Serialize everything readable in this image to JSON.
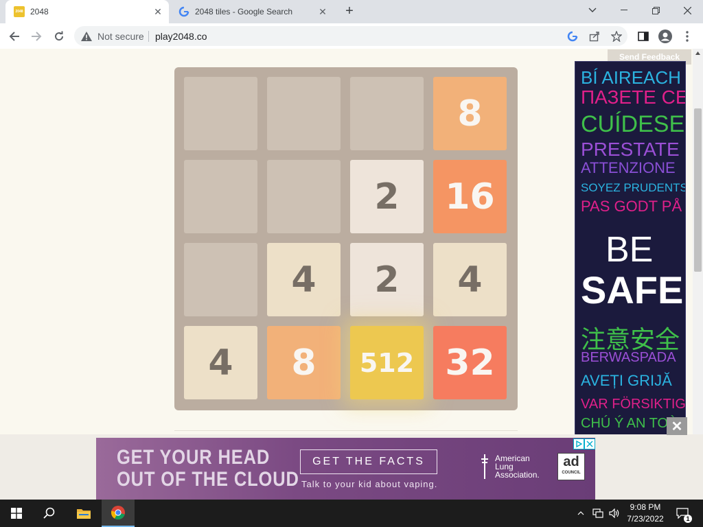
{
  "browser": {
    "tabs": [
      {
        "title": "2048",
        "favicon_text": "2048"
      },
      {
        "title": "2048 tiles - Google Search"
      }
    ],
    "omnibox": {
      "security": "Not secure",
      "url": "play2048.co"
    }
  },
  "game": {
    "tiles": [
      [
        "",
        "",
        "",
        "8"
      ],
      [
        "",
        "",
        "2",
        "16"
      ],
      [
        "",
        "4",
        "2",
        "4"
      ],
      [
        "4",
        "8",
        "512",
        "32"
      ]
    ]
  },
  "side_ad": {
    "feedback": "Send Feedback",
    "lines": [
      {
        "text": "BÍ AIREACH",
        "color": "#2bb3e0"
      },
      {
        "text": "ПАЗЕТЕ СЕ",
        "color": "#e0208a"
      },
      {
        "text": "CUÍDESE",
        "color": "#3fc04a"
      },
      {
        "text": "PRESTATE",
        "color": "#9b4fd6"
      },
      {
        "text": "ATTENZIONE",
        "color": "#8a4fd6"
      },
      {
        "text": "SOYEZ PRUDENTS",
        "color": "#2bb3e0"
      },
      {
        "text": "PAS GODT PÅ",
        "color": "#e0208a"
      },
      {
        "text": "BE",
        "color": "#ffffff"
      },
      {
        "text": "SAFE",
        "color": "#ffffff"
      },
      {
        "text": "注意安全",
        "color": "#3fc04a"
      },
      {
        "text": "BERWASPADA",
        "color": "#9b4fd6"
      },
      {
        "text": "AVEȚI GRIJĂ",
        "color": "#2bb3e0"
      },
      {
        "text": "VAR FÖRSIKTIG",
        "color": "#e0208a"
      },
      {
        "text": "CHÚ Ý AN TOÀ",
        "color": "#3fc04a"
      }
    ]
  },
  "bottom_ad": {
    "headline_1": "GET YOUR HEAD",
    "headline_2": "OUT OF THE CLOUD",
    "cta": "GET THE FACTS",
    "subtext": "Talk to your kid about vaping.",
    "sponsor_1": "American",
    "sponsor_2": "Lung",
    "sponsor_3": "Association.",
    "badge_1": "ad",
    "badge_2": "COUNCIL",
    "close": "✕"
  },
  "taskbar": {
    "time": "9:08 PM",
    "date": "7/23/2022",
    "notifications": "1"
  }
}
